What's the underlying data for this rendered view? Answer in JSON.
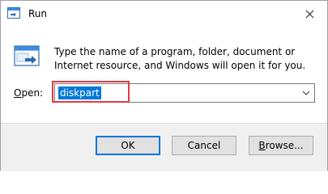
{
  "window": {
    "title": "Run"
  },
  "description": "Type the name of a program, folder, document or Internet resource, and Windows will open it for you.",
  "open_field": {
    "label_accel": "O",
    "label_rest": "pen:",
    "value": "diskpart"
  },
  "buttons": {
    "ok": "OK",
    "cancel": "Cancel",
    "browse_accel": "B",
    "browse_rest": "rowse..."
  },
  "icons": {
    "app": "run-icon",
    "close": "close-icon",
    "dropdown": "chevron-down-icon"
  },
  "colors": {
    "selection": "#0078d7",
    "highlight": "#e03a47",
    "footer": "#f0f0f0"
  }
}
